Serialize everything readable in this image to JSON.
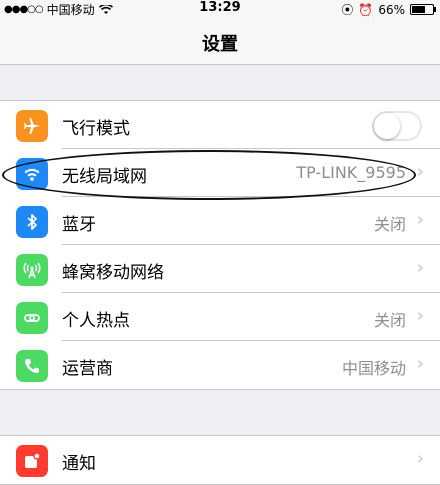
{
  "status": {
    "signal_dots": "●●●○○",
    "carrier": "中国移动",
    "time": "13:29",
    "battery_percent": "66%",
    "battery_level": 0.66
  },
  "nav": {
    "title": "设置"
  },
  "groups": [
    {
      "rows": [
        {
          "label": "飞行模式",
          "icon": "airplane-icon",
          "icon_color": "#f7931e",
          "toggle": false
        },
        {
          "label": "无线局域网",
          "icon": "wifi-icon",
          "icon_color": "#1e88f5",
          "value": "TP-LINK_9595"
        },
        {
          "label": "蓝牙",
          "icon": "bluetooth-icon",
          "icon_color": "#1e88f5",
          "value": "关闭"
        },
        {
          "label": "蜂窝移动网络",
          "icon": "cellular-icon",
          "icon_color": "#4cd964",
          "value": ""
        },
        {
          "label": "个人热点",
          "icon": "hotspot-icon",
          "icon_color": "#4cd964",
          "value": "关闭"
        },
        {
          "label": "运营商",
          "icon": "phone-icon",
          "icon_color": "#4cd964",
          "value": "中国移动"
        }
      ]
    },
    {
      "rows": [
        {
          "label": "通知",
          "icon": "notifications-icon",
          "icon_color": "#ff3b30",
          "value": ""
        }
      ]
    }
  ],
  "chevron": "›"
}
